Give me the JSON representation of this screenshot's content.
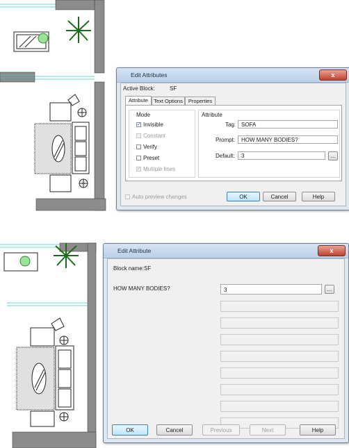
{
  "top_dialog": {
    "title": "Edit Attributes",
    "close_glyph": "x",
    "active_block_label": "Active Block:",
    "active_block_value": "SF",
    "tabs": [
      "Attribute",
      "Text Options",
      "Properties"
    ],
    "mode": {
      "label": "Mode",
      "options": [
        {
          "label": "Invisible",
          "checked": true,
          "enabled": true
        },
        {
          "label": "Constant",
          "checked": false,
          "enabled": false
        },
        {
          "label": "Verify",
          "checked": false,
          "enabled": true
        },
        {
          "label": "Preset",
          "checked": false,
          "enabled": true
        },
        {
          "label": "Multiple lines",
          "checked": true,
          "enabled": false
        }
      ]
    },
    "attribute": {
      "label": "Attribute",
      "tag_label": "Tag:",
      "tag_value": "SOFA",
      "prompt_label": "Prompt:",
      "prompt_value": "HOW MANY BODIES?",
      "default_label": "Default:",
      "default_value": "3",
      "browse_glyph": "..."
    },
    "auto_preview_label": "Auto preview changes",
    "buttons": {
      "ok": "OK",
      "cancel": "Cancel",
      "help": "Help"
    }
  },
  "bottom_dialog": {
    "title": "Edit Attribute",
    "close_glyph": "x",
    "block_name": "Block name:SF",
    "prompt": "HOW MANY BODIES?",
    "value": "3",
    "browse_glyph": "...",
    "buttons": {
      "ok": "OK",
      "cancel": "Cancel",
      "previous": "Previous",
      "next": "Next",
      "help": "Help"
    }
  },
  "colors": {
    "wall": "#8c8c8c",
    "plant": "#2e8b2e",
    "window_line": "#36c6c0",
    "dialog_frame": "#dfe7f1",
    "close_button": "#c2412c"
  }
}
